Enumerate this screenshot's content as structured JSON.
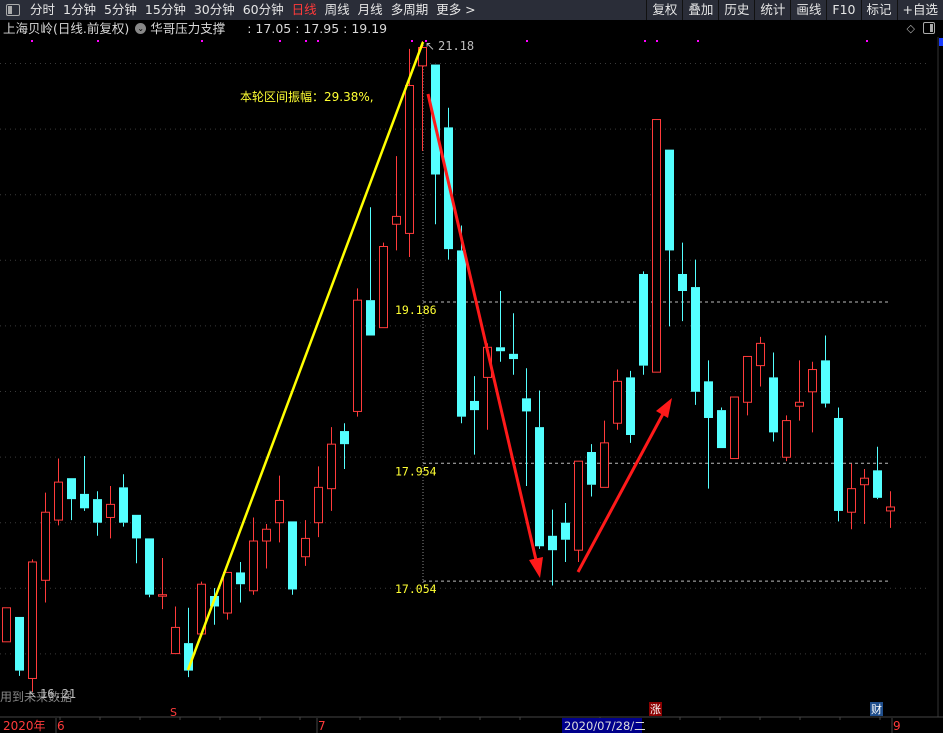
{
  "toolbar": {
    "periods": [
      {
        "label": "分时",
        "active": false
      },
      {
        "label": "1分钟",
        "active": false
      },
      {
        "label": "5分钟",
        "active": false
      },
      {
        "label": "15分钟",
        "active": false
      },
      {
        "label": "30分钟",
        "active": false
      },
      {
        "label": "60分钟",
        "active": false
      },
      {
        "label": "日线",
        "active": true
      },
      {
        "label": "周线",
        "active": false
      },
      {
        "label": "月线",
        "active": false
      },
      {
        "label": "多周期",
        "active": false
      },
      {
        "label": "更多 >",
        "active": false
      }
    ],
    "right": [
      "复权",
      "叠加",
      "历史",
      "统计",
      "画线",
      "F10",
      "标记",
      "+自选"
    ]
  },
  "header": {
    "stock_title": "上海贝岭(日线.前复权)",
    "indicator_name": "华哥压力支撑",
    "indicator_values": ": 17.05 : 17.95 : 19.19"
  },
  "chart_data": {
    "type": "candlestick",
    "colors": {
      "up": "#ff3b3b",
      "down": "#54ffff",
      "background": "#000000",
      "trend_up": "#ffff00",
      "arrow": "#ff1a1a",
      "level": "#ffff33"
    },
    "y_range": [
      16.0,
      21.3
    ],
    "candles": [
      [
        16.59,
        16.85,
        16.85,
        16.59
      ],
      [
        16.78,
        16.37,
        16.78,
        16.33
      ],
      [
        16.31,
        17.2,
        17.22,
        16.21
      ],
      [
        17.06,
        17.58,
        17.73,
        16.89
      ],
      [
        17.52,
        17.81,
        17.99,
        17.48
      ],
      [
        17.84,
        17.68,
        17.84,
        17.52
      ],
      [
        17.72,
        17.61,
        18.01,
        17.59
      ],
      [
        17.68,
        17.5,
        17.74,
        17.4
      ],
      [
        17.54,
        17.64,
        17.78,
        17.38
      ],
      [
        17.77,
        17.5,
        17.87,
        17.47
      ],
      [
        17.56,
        17.38,
        17.56,
        17.19
      ],
      [
        17.38,
        16.95,
        17.38,
        16.93
      ],
      [
        16.94,
        16.95,
        17.23,
        16.84
      ],
      [
        16.5,
        16.7,
        16.86,
        16.5
      ],
      [
        16.58,
        16.37,
        16.85,
        16.32
      ],
      [
        16.65,
        17.03,
        17.05,
        16.65
      ],
      [
        16.94,
        16.86,
        17.0,
        16.72
      ],
      [
        16.81,
        17.12,
        17.12,
        16.76
      ],
      [
        17.12,
        17.03,
        17.2,
        16.89
      ],
      [
        16.98,
        17.36,
        17.54,
        16.95
      ],
      [
        17.36,
        17.45,
        17.49,
        17.15
      ],
      [
        17.5,
        17.67,
        17.86,
        17.35
      ],
      [
        17.51,
        16.99,
        17.51,
        16.95
      ],
      [
        17.24,
        17.38,
        17.52,
        17.17
      ],
      [
        17.5,
        17.77,
        17.93,
        17.39
      ],
      [
        17.76,
        18.1,
        18.23,
        17.59
      ],
      [
        18.2,
        18.1,
        18.26,
        17.91
      ],
      [
        18.35,
        19.2,
        19.29,
        18.31
      ],
      [
        19.2,
        18.93,
        19.91,
        18.93
      ],
      [
        18.99,
        19.61,
        19.64,
        18.99
      ],
      [
        19.78,
        19.84,
        20.3,
        19.58
      ],
      [
        19.71,
        20.84,
        21.12,
        19.53
      ],
      [
        20.99,
        21.13,
        21.18,
        20.34
      ],
      [
        21.0,
        20.16,
        21.0,
        19.78
      ],
      [
        20.52,
        19.59,
        20.67,
        19.51
      ],
      [
        19.58,
        18.31,
        19.77,
        18.26
      ],
      [
        18.43,
        18.36,
        18.62,
        18.02
      ],
      [
        18.61,
        18.84,
        18.87,
        18.21
      ],
      [
        18.84,
        18.81,
        19.27,
        18.73
      ],
      [
        18.79,
        18.75,
        19.1,
        18.63
      ],
      [
        18.45,
        18.35,
        18.68,
        17.78
      ],
      [
        18.23,
        17.32,
        18.51,
        17.3
      ],
      [
        17.4,
        17.29,
        17.6,
        17.02
      ],
      [
        17.5,
        17.37,
        17.65,
        17.2
      ],
      [
        17.29,
        17.97,
        17.97,
        17.2
      ],
      [
        18.04,
        17.79,
        18.1,
        17.7
      ],
      [
        17.77,
        18.11,
        18.28,
        17.77
      ],
      [
        18.26,
        18.58,
        18.67,
        18.21
      ],
      [
        18.61,
        18.17,
        18.66,
        18.11
      ],
      [
        19.4,
        18.7,
        19.42,
        18.63
      ],
      [
        18.65,
        20.58,
        20.58,
        18.65
      ],
      [
        20.35,
        19.58,
        20.35,
        19.0
      ],
      [
        19.4,
        19.27,
        19.64,
        19.04
      ],
      [
        19.3,
        18.5,
        19.51,
        18.4
      ],
      [
        18.58,
        18.3,
        18.74,
        17.76
      ],
      [
        18.36,
        18.07,
        18.38,
        18.07
      ],
      [
        17.99,
        18.46,
        18.46,
        17.99
      ],
      [
        18.42,
        18.77,
        18.77,
        18.32
      ],
      [
        18.7,
        18.87,
        18.92,
        18.54
      ],
      [
        18.61,
        18.19,
        18.8,
        18.12
      ],
      [
        18.0,
        18.28,
        18.32,
        17.97
      ],
      [
        18.39,
        18.42,
        18.74,
        18.28
      ],
      [
        18.5,
        18.67,
        18.73,
        18.19
      ],
      [
        18.74,
        18.41,
        18.93,
        18.38
      ],
      [
        18.3,
        17.59,
        18.38,
        17.51
      ],
      [
        17.58,
        17.76,
        17.95,
        17.45
      ],
      [
        17.79,
        17.84,
        17.91,
        17.49
      ],
      [
        17.9,
        17.69,
        18.08,
        17.68
      ],
      [
        17.59,
        17.62,
        17.74,
        17.46
      ]
    ],
    "levels": [
      {
        "label": "19.186",
        "value": 19.186
      },
      {
        "label": "17.954",
        "value": 17.954
      },
      {
        "label": "17.054",
        "value": 17.054
      }
    ],
    "high_label": "21.18",
    "low_label": "16.21",
    "amplitude_text": "本轮区间振幅：29.38%,",
    "warning_text": "用到未来数据",
    "x_axis": {
      "year": "2020年",
      "ticks": [
        "6",
        "7",
        "9"
      ],
      "cursor_date": "2020/07/28/二"
    },
    "markers": {
      "s": "S",
      "zhang": "涨",
      "cai": "财"
    }
  }
}
